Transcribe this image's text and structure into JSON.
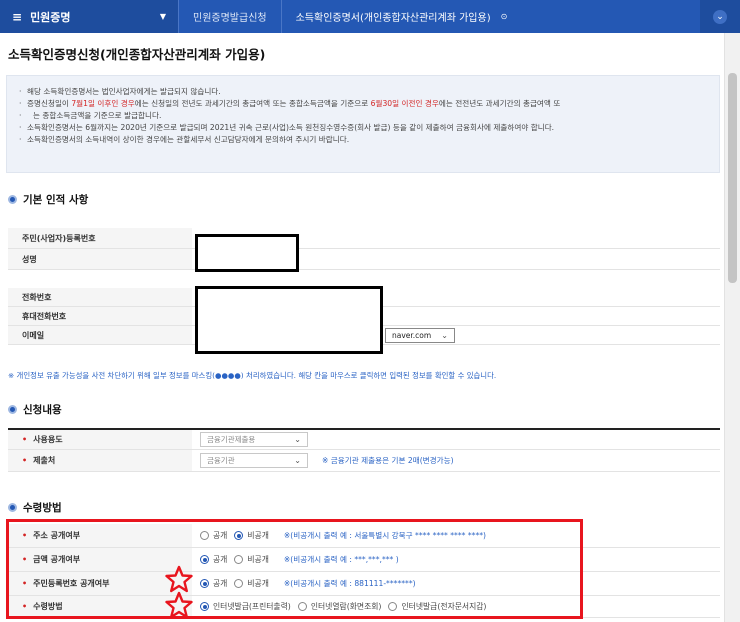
{
  "topnav": {
    "home_label": "민원증명",
    "items": [
      "민원증명발급신청",
      "소득확인증명서(개인종합자산관리계좌 가입용)"
    ]
  },
  "page_title": "소득확인증명신청(개인종합자산관리계좌 가입용)",
  "notice": {
    "line1": "해당 소득확인증명서는 법인사업자에게는 발급되지 않습니다.",
    "line2a": "증명신청일이 ",
    "line2b": "7월1일 이후인 경우",
    "line2c": "에는 신청일의 전년도 과세기간의 총급여액 또는 종합소득금액을 기준으로 ",
    "line2d": "6월30일 이전인 경우",
    "line2e": "에는 전전년도 과세기간의 총급여액 또",
    "line3": "는 종합소득금액을 기준으로 발급합니다.",
    "line4": "소득확인증명서는 6월까지는 2020년 기준으로 발급되며 2021년 귀속 근로(사업)소득 원천징수영수증(회사 발급) 등을 같이 제출하여 금융회사에 제출하여야 합니다.",
    "line5": "소득확인증명서의 소득내역이 상이한 경우에는 관할세무서 신고담당자에게 문의하여 주시기 바랍니다."
  },
  "sections": {
    "basic": {
      "title": "기본 인적 사항",
      "rows": [
        "주민(사업자)등록번호",
        "성명",
        "전화번호",
        "휴대전화번호",
        "이메일"
      ],
      "email_domain": "naver.com"
    },
    "mask_note": "※ 개인정보 유출 가능성을 사전 차단하기 위해 일부 정보를 마스킹(●●●●) 처리하였습니다. 해당 칸을 마우스로 클릭하면 입력된 정보를 확인할 수 있습니다.",
    "apply": {
      "title": "신청내용",
      "usage_label": "사용용도",
      "usage_value": "금융기관제출용",
      "submit_label": "제출처",
      "submit_value": "금융기관",
      "submit_hint": "※ 금융기관 제출용은 기본 2매(변경가능)"
    },
    "receive": {
      "title": "수령방법",
      "rows": [
        {
          "label": "주소 공개여부",
          "opts": [
            "공개",
            "비공개"
          ],
          "hint": "※(비공개시 출력 예 : 서울특별시 강북구 **** **** **** ****)"
        },
        {
          "label": "금액 공개여부",
          "opts": [
            "공개",
            "비공개"
          ],
          "hint": "※(비공개시 출력 예 : ***,***,*** )"
        },
        {
          "label": "주민등록번호 공개여부",
          "opts": [
            "공개",
            "비공개"
          ],
          "hint": "※(비공개시 출력 예 : 881111-*******)"
        },
        {
          "label": "수령방법",
          "opts": [
            "인터넷발급(프린터출력)",
            "인터넷열람(화면조회)",
            "인터넷발급(전자문서지갑)"
          ],
          "hint": ""
        }
      ]
    }
  },
  "colors": {
    "brand": "#2458b4",
    "alert": "#e8151e"
  }
}
